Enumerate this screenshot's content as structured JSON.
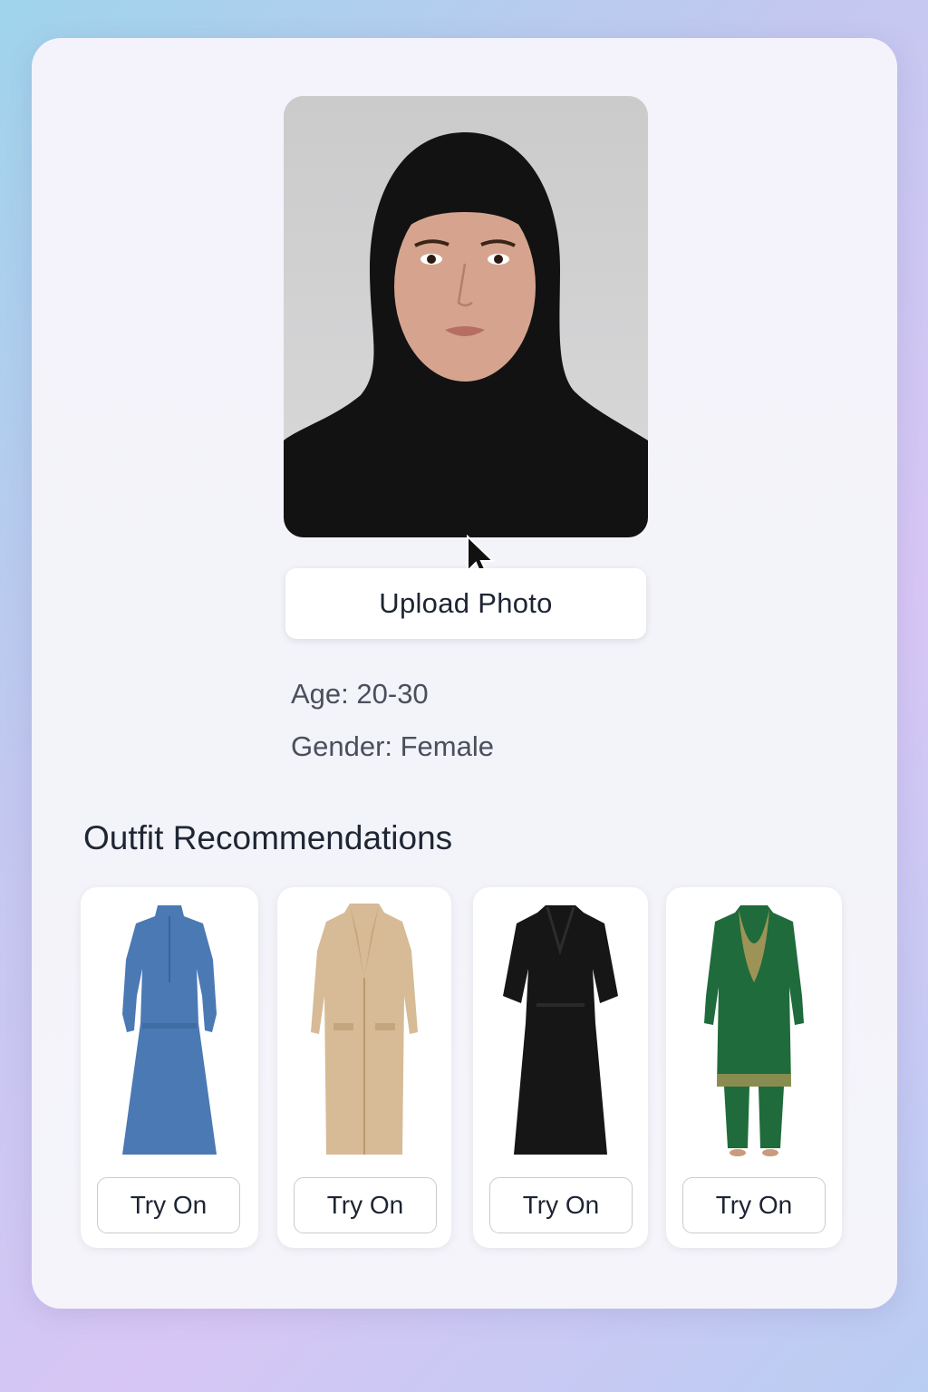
{
  "profile": {
    "photo_alt": "uploaded portrait",
    "upload_label": "Upload Photo",
    "age_text": "Age: 20-30",
    "gender_text": "Gender: Female"
  },
  "recommendations": {
    "title": "Outfit Recommendations",
    "items": [
      {
        "name": "blue-dress",
        "color": "#4a79b4",
        "button_label": "Try On"
      },
      {
        "name": "beige-coat",
        "color": "#d6bb96",
        "button_label": "Try On"
      },
      {
        "name": "black-abaya",
        "color": "#161616",
        "button_label": "Try On"
      },
      {
        "name": "green-embroidered-kurta-set",
        "color": "#1f6b3c",
        "button_label": "Try On"
      }
    ]
  }
}
